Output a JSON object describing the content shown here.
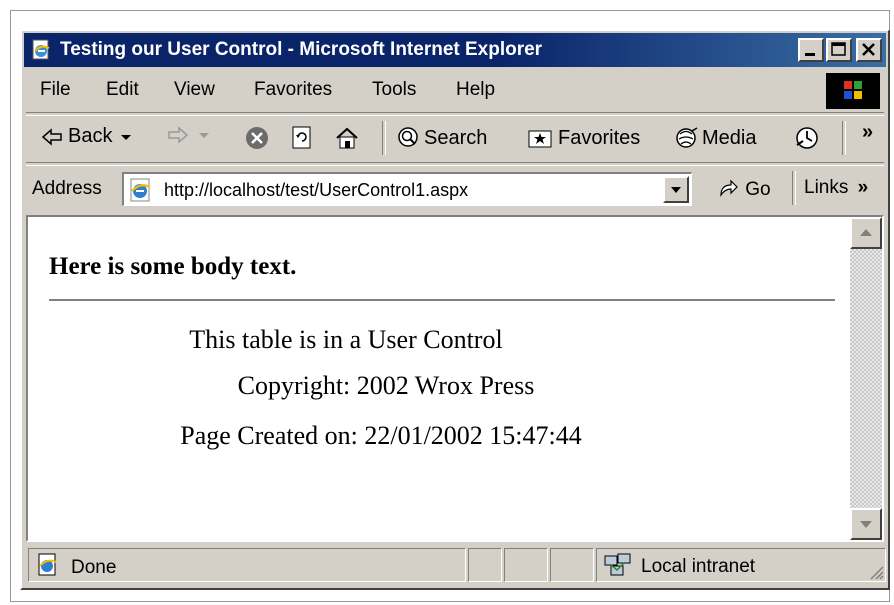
{
  "window": {
    "title": "Testing our User Control - Microsoft Internet Explorer"
  },
  "menu": [
    "File",
    "Edit",
    "View",
    "Favorites",
    "Tools",
    "Help"
  ],
  "toolbar": {
    "back": "Back",
    "search": "Search",
    "favorites": "Favorites",
    "media": "Media",
    "overflow": "»"
  },
  "address": {
    "label": "Address",
    "url": "http://localhost/test/UserControl1.aspx",
    "go": "Go",
    "links": "Links",
    "links_overflow": "»"
  },
  "page": {
    "heading": "Here is some body text.",
    "line1": "This table is in a User Control",
    "line2": "Copyright: 2002 Wrox Press",
    "line3": "Page Created on: 22/01/2002 15:47:44"
  },
  "status": {
    "text": "Done",
    "zone": "Local intranet"
  },
  "colors": {
    "title_bar": "#0a246a",
    "chrome": "#d4d0c8"
  },
  "icons": [
    "ie-page-icon",
    "minimize-icon",
    "maximize-icon",
    "close-icon",
    "windows-logo-icon",
    "back-arrow-icon",
    "forward-arrow-icon",
    "stop-icon",
    "refresh-icon",
    "home-icon",
    "search-icon",
    "favorites-icon",
    "media-icon",
    "history-icon",
    "ie-address-icon",
    "dropdown-arrow-icon",
    "go-arrow-icon",
    "scroll-up-icon",
    "scroll-down-icon",
    "done-page-icon",
    "intranet-icon",
    "resize-grip-icon"
  ]
}
